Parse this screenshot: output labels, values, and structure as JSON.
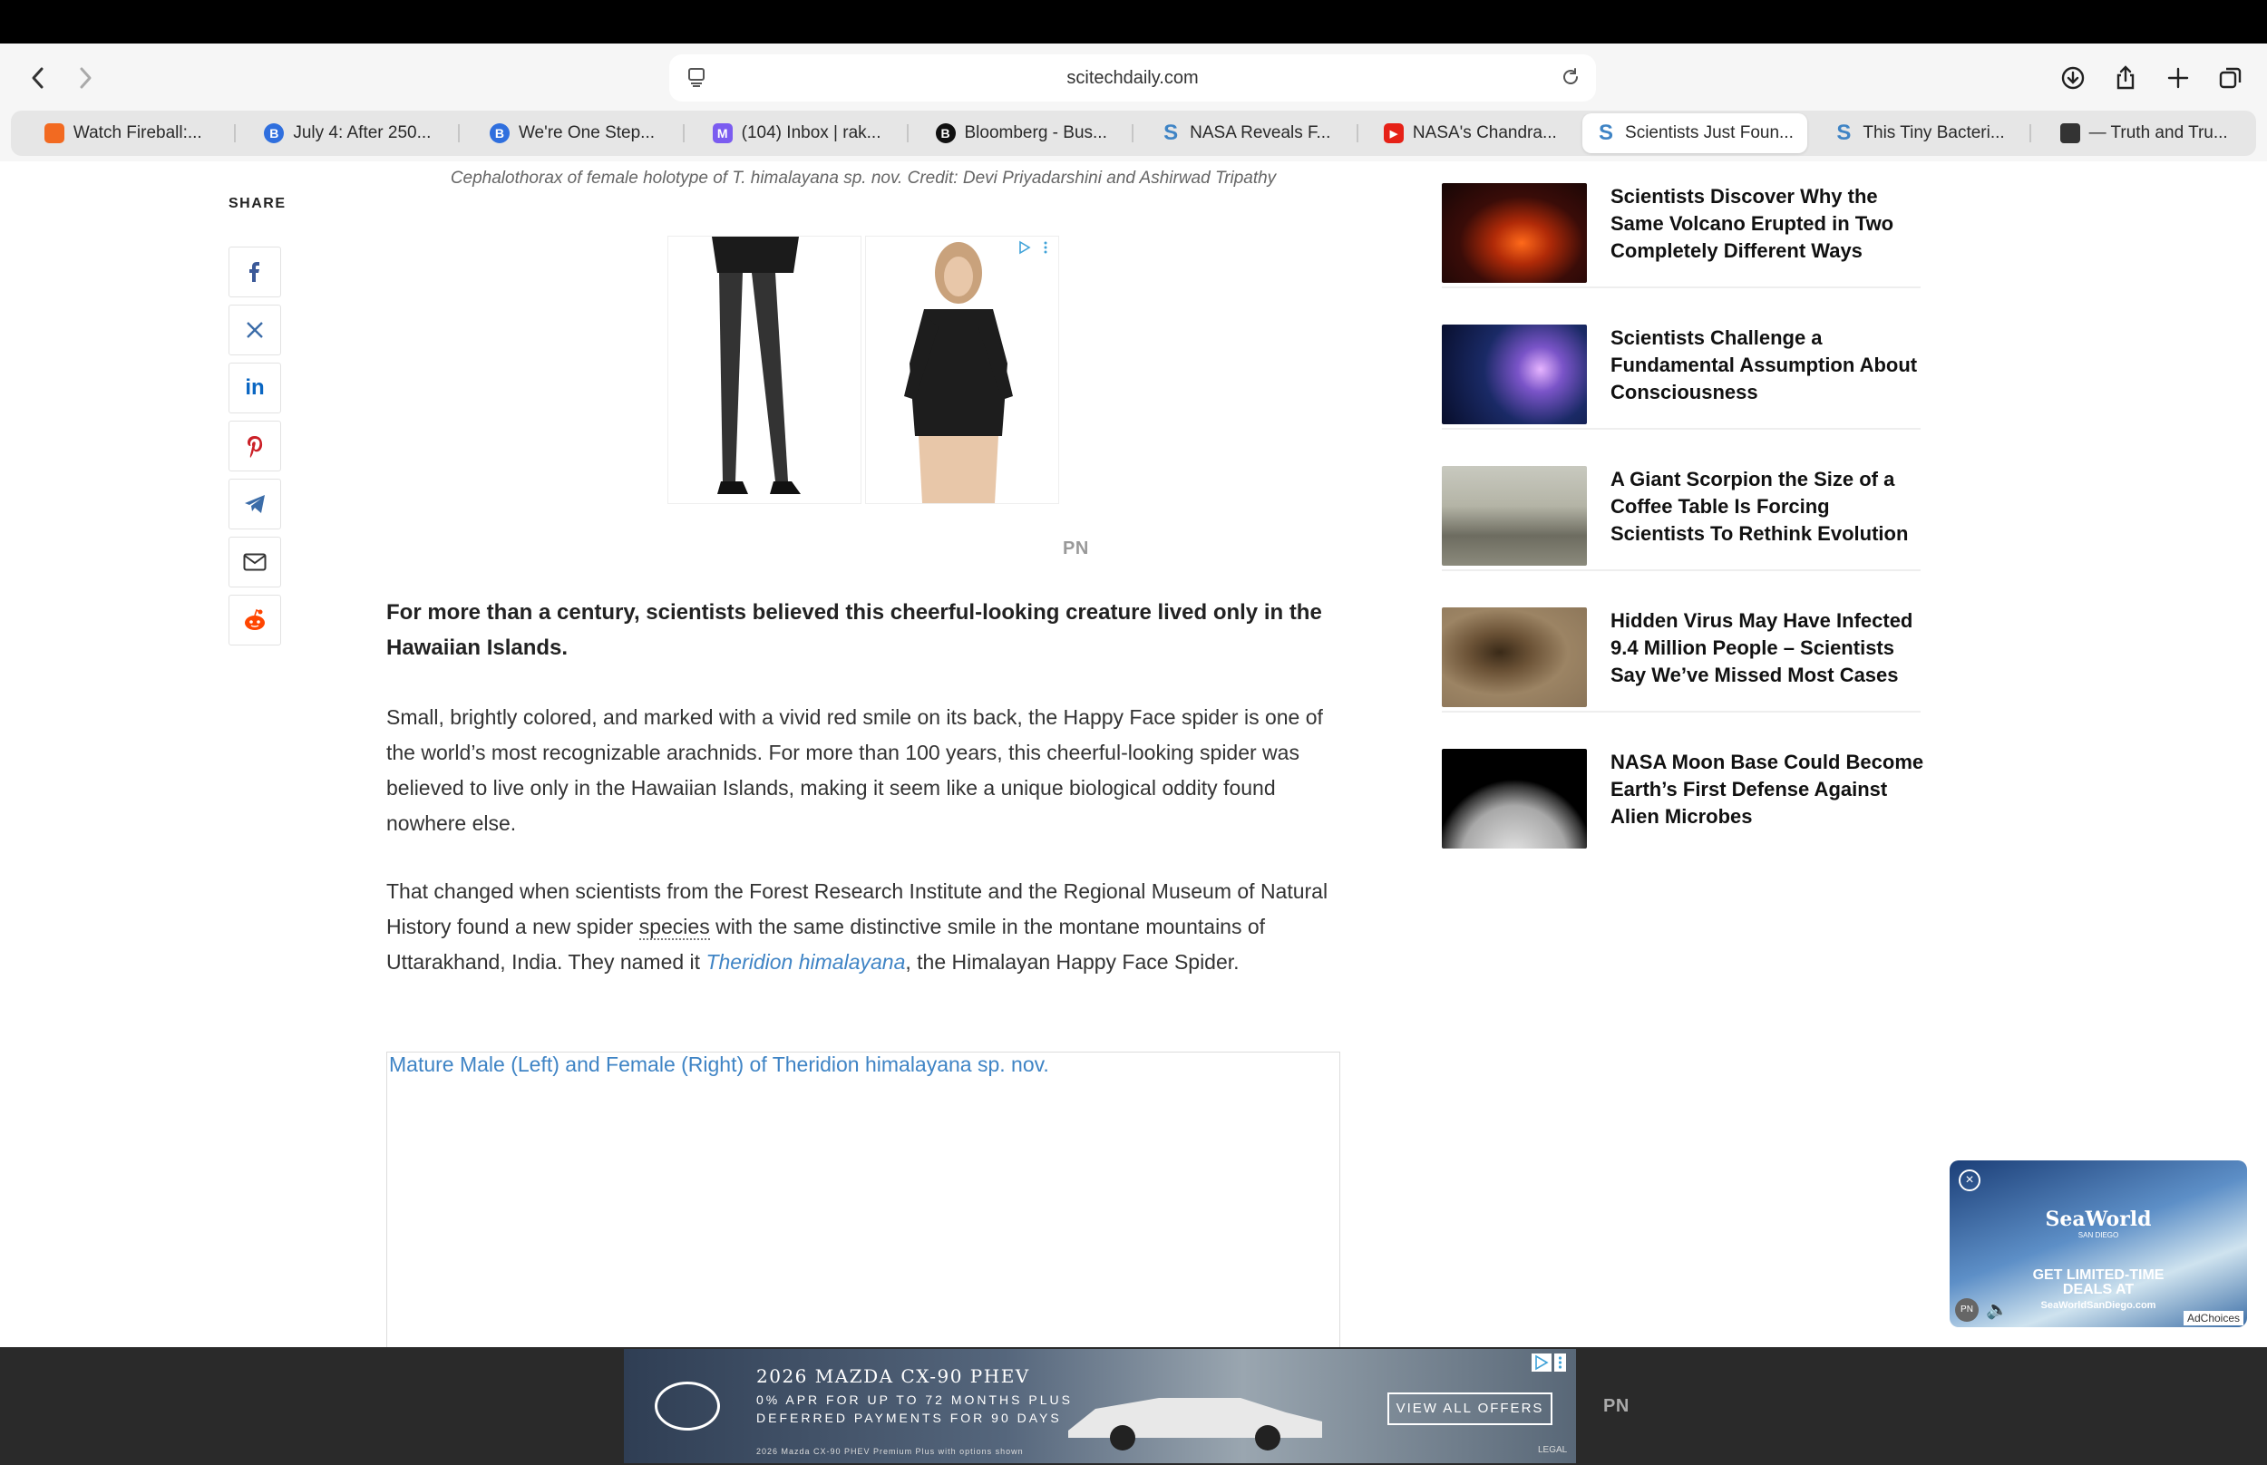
{
  "browser": {
    "url": "scitechdaily.com",
    "tabs": [
      {
        "label": "Watch Fireball:...",
        "icon": "orange-square-icon",
        "color": "#f26a21",
        "glyph": ""
      },
      {
        "label": "July 4: After 250...",
        "icon": "b-circle-icon",
        "color": "#2f6fde",
        "glyph": "B"
      },
      {
        "label": "We're One Step...",
        "icon": "b-circle-icon",
        "color": "#2f6fde",
        "glyph": "B"
      },
      {
        "label": "(104) Inbox | rak...",
        "icon": "mail-icon",
        "color": "#7b5cf0",
        "glyph": "M"
      },
      {
        "label": "Bloomberg - Bus...",
        "icon": "bloomberg-icon",
        "color": "#111111",
        "glyph": "B"
      },
      {
        "label": "NASA Reveals F...",
        "icon": "scitech-s-icon",
        "color": "#3f84c5",
        "glyph": "S"
      },
      {
        "label": "NASA's Chandra...",
        "icon": "youtube-icon",
        "color": "#e62117",
        "glyph": "▶"
      },
      {
        "label": "Scientists Just Foun...",
        "icon": "scitech-s-icon",
        "color": "#3f84c5",
        "glyph": "S"
      },
      {
        "label": "This Tiny Bacteri...",
        "icon": "scitech-s-icon",
        "color": "#3f84c5",
        "glyph": "S"
      },
      {
        "label": "— Truth and Tru...",
        "icon": "cube-icon",
        "color": "#333333",
        "glyph": ""
      }
    ],
    "active_tab": 7
  },
  "article": {
    "image_caption": "Cephalothorax of female holotype of T. himalayana sp. nov. Credit: Devi Priyadarshini and Ashirwad Tripathy",
    "share_label": "SHARE",
    "share_icons": [
      "facebook-icon",
      "x-icon",
      "linkedin-icon",
      "pinterest-icon",
      "telegram-icon",
      "email-icon",
      "reddit-icon"
    ],
    "lead": "For more than a century, scientists believed this cheerful-looking creature lived only in the Hawaiian Islands.",
    "p1": "Small, brightly colored, and marked with a vivid red smile on its back, the Happy Face spider is one of the world’s most recognizable arachnids. For more than 100 years, this cheerful-looking spider was believed to live only in the Hawaiian Islands, making it seem like a unique biological oddity found nowhere else.",
    "p2_a": "That changed when scientists from the Forest Research Institute and the Regional Museum of Natural History found a new spider ",
    "p2_link": "species",
    "p2_b": " with the same distinctive smile in the montane mountains of Uttarakhand, India. They named it ",
    "p2_italic": "Theridion himalayana",
    "p2_c": ", the Himalayan Happy Face Spider.",
    "figure_title": "Mature Male (Left) and Female (Right) of Theridion himalayana sp. nov."
  },
  "ads": {
    "pn_label": "PN",
    "mazda_title": "2026 MAZDA CX-90 PHEV",
    "mazda_line1": "0% APR FOR UP TO 72 MONTHS PLUS",
    "mazda_line2": "DEFERRED PAYMENTS FOR 90 DAYS",
    "mazda_fine": "2026 Mazda CX-90 PHEV Premium Plus with options shown",
    "mazda_cta": "VIEW ALL OFFERS",
    "mazda_legal": "LEGAL",
    "seaworld_brand": "SeaWorld",
    "seaworld_sub": "SAN DIEGO",
    "seaworld_deal1": "GET LIMITED-TIME",
    "seaworld_deal2": "DEALS AT",
    "seaworld_url": "SeaWorldSanDiego.com",
    "adchoices": "AdChoices"
  },
  "sidebar": {
    "items": [
      {
        "title": "Scientists Discover Why the Same Volcano Erupted in Two Completely Different Ways"
      },
      {
        "title": "Scientists Challenge a Fundamental Assumption About Consciousness"
      },
      {
        "title": "A Giant Scorpion the Size of a Coffee Table Is Forcing Scientists To Rethink Evolution"
      },
      {
        "title": "Hidden Virus May Have Infected 9.4 Million People – Scientists Say We’ve Missed Most Cases"
      },
      {
        "title": "NASA Moon Base Could Become Earth’s First Defense Against Alien Microbes"
      }
    ]
  }
}
